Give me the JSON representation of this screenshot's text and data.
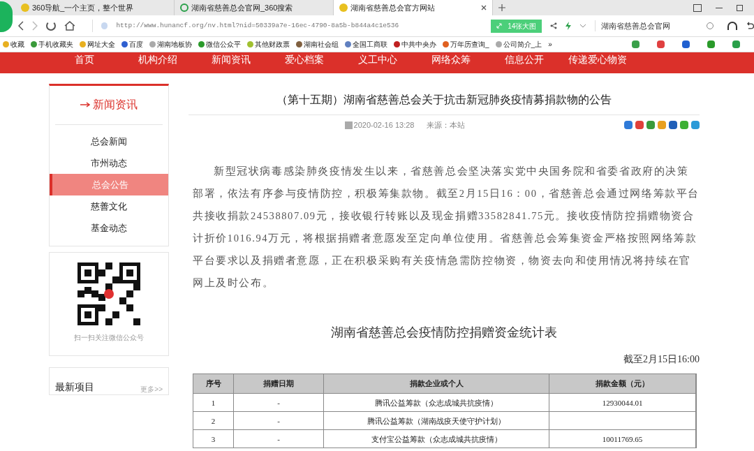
{
  "tabs": [
    {
      "label": "360导航_一个主页，整个世界",
      "selected": false
    },
    {
      "label": "湖南省慈善总会官网_360搜索",
      "selected": false
    },
    {
      "label": "湖南省慈善总会官方网站",
      "selected": true
    }
  ],
  "address": {
    "url": "http://www.hunancf.org/nv.html?nid=50339a7e-16ec-4790-8a5b-b844a4c1e536",
    "images_button": "14张大图",
    "search_value": "湖南省慈善总会官网"
  },
  "bookmarks": [
    "收藏",
    "手机收藏夹",
    "网址大全",
    "百度",
    "湖南地板协",
    "微信公众平",
    "其他财政票",
    "湖南社会组",
    "全国工商联",
    "中共中央办",
    "万年历查询_",
    "公司简介_上",
    "»"
  ],
  "nav": [
    "首页",
    "机构介绍",
    "新闻资讯",
    "爱心档案",
    "义工中心",
    "网络众筹",
    "信息公开",
    "传递爱心物资"
  ],
  "sidebar": {
    "title": "新闻资讯",
    "items": [
      {
        "label": "总会新闻",
        "selected": false
      },
      {
        "label": "市州动态",
        "selected": false
      },
      {
        "label": "总会公告",
        "selected": true
      },
      {
        "label": "慈善文化",
        "selected": false
      },
      {
        "label": "基金动态",
        "selected": false
      }
    ],
    "qr_caption": "扫一扫关注微信公众号",
    "latest_title": "最新项目",
    "latest_more": "更多>>"
  },
  "article": {
    "title": "（第十五期）湖南省慈善总会关于抗击新冠肺炎疫情募捐款物的公告",
    "date": "2020-02-16 13:28",
    "source": "来源：本站",
    "body": "新型冠状病毒感染肺炎疫情发生以来，省慈善总会坚决落实党中央国务院和省委省政府的决策部署，依法有序参与疫情防控，积极筹集款物。截至2月15日16：00，省慈善总会通过网络筹款平台共接收捐款24538807.09元，接收银行转账以及现金捐赠33582841.75元。接收疫情防控捐赠物资合计折价1016.94万元，将根据捐赠者意愿发至定向单位使用。省慈善总会筹集资金严格按照网络筹款平台要求以及捐赠者意愿，正在积极采购有关疫情急需防控物资，物资去向和使用情况将持续在官网上及时公布。",
    "table_title": "湖南省慈善总会疫情防控捐赠资金统计表",
    "as_of": "截至2月15日16:00",
    "columns": [
      "序号",
      "捐赠日期",
      "捐款企业或个人",
      "捐款金额（元）"
    ],
    "rows": [
      [
        "1",
        "-",
        "腾讯公益筹款（众志成城共抗疫情）",
        "12930044.01"
      ],
      [
        "2",
        "-",
        "腾讯公益筹款（湖南战疫天使守护计划）"
      ],
      [
        "3",
        "-",
        "支付宝公益筹款（众志成城共抗疫情）",
        "10011769.65"
      ]
    ]
  }
}
